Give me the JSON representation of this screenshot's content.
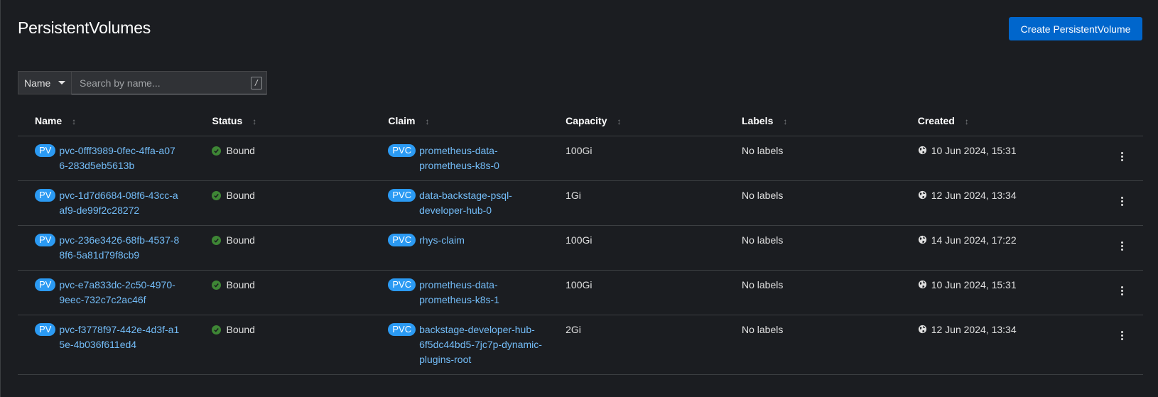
{
  "header": {
    "title": "PersistentVolumes",
    "create_button": "Create PersistentVolume"
  },
  "filter": {
    "selected": "Name",
    "placeholder": "Search by name...",
    "shortcut": "/"
  },
  "table": {
    "columns": [
      "Name",
      "Status",
      "Claim",
      "Capacity",
      "Labels",
      "Created"
    ],
    "rows": [
      {
        "kind": "PV",
        "name": "pvc-0fff3989-0fec-4ffa-a076-283d5eb5613b",
        "status": "Bound",
        "claim_kind": "PVC",
        "claim": "prometheus-data-prometheus-k8s-0",
        "capacity": "100Gi",
        "labels": "No labels",
        "created": "10 Jun 2024, 15:31"
      },
      {
        "kind": "PV",
        "name": "pvc-1d7d6684-08f6-43cc-aaf9-de99f2c28272",
        "status": "Bound",
        "claim_kind": "PVC",
        "claim": "data-backstage-psql-developer-hub-0",
        "capacity": "1Gi",
        "labels": "No labels",
        "created": "12 Jun 2024, 13:34"
      },
      {
        "kind": "PV",
        "name": "pvc-236e3426-68fb-4537-88f6-5a81d79f8cb9",
        "status": "Bound",
        "claim_kind": "PVC",
        "claim": "rhys-claim",
        "capacity": "100Gi",
        "labels": "No labels",
        "created": "14 Jun 2024, 17:22"
      },
      {
        "kind": "PV",
        "name": "pvc-e7a833dc-2c50-4970-9eec-732c7c2ac46f",
        "status": "Bound",
        "claim_kind": "PVC",
        "claim": "prometheus-data-prometheus-k8s-1",
        "capacity": "100Gi",
        "labels": "No labels",
        "created": "10 Jun 2024, 15:31"
      },
      {
        "kind": "PV",
        "name": "pvc-f3778f97-442e-4d3f-a15e-4b036f611ed4",
        "status": "Bound",
        "claim_kind": "PVC",
        "claim": "backstage-developer-hub-6f5dc44bd5-7jc7p-dynamic-plugins-root",
        "capacity": "2Gi",
        "labels": "No labels",
        "created": "12 Jun 2024, 13:34"
      }
    ]
  },
  "icons": {
    "status_ok": "check-circle-icon",
    "created": "globe-icon",
    "row_actions": "kebab-icon",
    "sort": "sort-icon"
  },
  "colors": {
    "accent": "#0066cc",
    "badge": "#2b9af3",
    "link": "#73bcf7",
    "success": "#3e8635",
    "background": "#1b1d21"
  }
}
